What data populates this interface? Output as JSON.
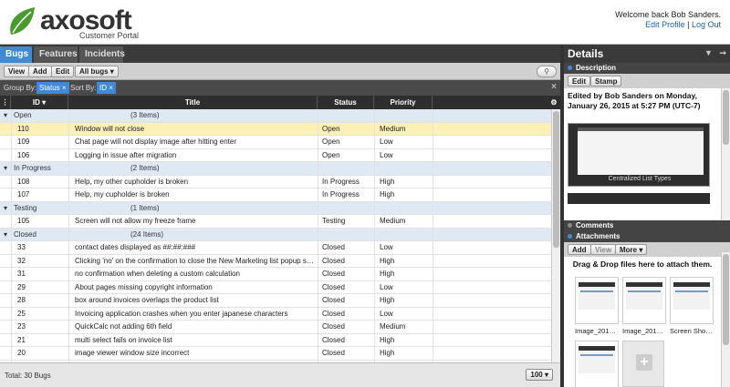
{
  "brand": {
    "name": "axosoft",
    "subtitle": "Customer Portal",
    "logo_color": "#4a9b2f"
  },
  "user": {
    "welcome": "Welcome back Bob Sanders.",
    "edit_profile": "Edit Profile",
    "separator": "|",
    "logout": "Log Out"
  },
  "tabs": [
    {
      "label": "Bugs",
      "active": true
    },
    {
      "label": "Features",
      "active": false
    },
    {
      "label": "Incidents",
      "active": false
    }
  ],
  "toolbar": {
    "view": "View",
    "add": "Add",
    "edit": "Edit",
    "filter": "All bugs",
    "search_icon": "search-icon"
  },
  "groupbar": {
    "group_label": "Group By:",
    "group_value": "Status",
    "sort_label": "Sort By:",
    "sort_value": "ID",
    "close": "×"
  },
  "columns": {
    "id": "ID",
    "title": "Title",
    "status": "Status",
    "priority": "Priority"
  },
  "groups": [
    {
      "name": "Open",
      "count": "(3 Items)",
      "rows": [
        {
          "id": "110",
          "title": "Window will not close",
          "status": "Open",
          "priority": "Medium",
          "selected": true
        },
        {
          "id": "109",
          "title": "Chat page will not display image after hitting enter",
          "status": "Open",
          "priority": "Low"
        },
        {
          "id": "106",
          "title": "Logging in issue after migration",
          "status": "Open",
          "priority": "Low"
        }
      ]
    },
    {
      "name": "In Progress",
      "count": "(2 Items)",
      "rows": [
        {
          "id": "108",
          "title": "Help, my other cupholder is broken",
          "status": "In Progress",
          "priority": "High"
        },
        {
          "id": "107",
          "title": "Help, my cupholder is broken",
          "status": "In Progress",
          "priority": "High"
        }
      ]
    },
    {
      "name": "Testing",
      "count": "(1 Items)",
      "rows": [
        {
          "id": "105",
          "title": "Screen will not allow my freeze frame",
          "status": "Testing",
          "priority": "Medium"
        }
      ]
    },
    {
      "name": "Closed",
      "count": "(24 Items)",
      "rows": [
        {
          "id": "33",
          "title": "contact dates displayed as ##:##:###",
          "status": "Closed",
          "priority": "Low"
        },
        {
          "id": "32",
          "title": "Clicking 'no' on the confirmation to close the New Marketing list popup s…",
          "status": "Closed",
          "priority": "High"
        },
        {
          "id": "31",
          "title": "no confirmation when deleting a custom calculation",
          "status": "Closed",
          "priority": "High"
        },
        {
          "id": "29",
          "title": "About pages missing copyright information",
          "status": "Closed",
          "priority": "Low"
        },
        {
          "id": "28",
          "title": "box around invoices overlaps the product list",
          "status": "Closed",
          "priority": "High"
        },
        {
          "id": "25",
          "title": "Invoicing application crashes when you enter japanese characters",
          "status": "Closed",
          "priority": "Low"
        },
        {
          "id": "23",
          "title": "QuickCalc not adding 6th field",
          "status": "Closed",
          "priority": "Medium"
        },
        {
          "id": "21",
          "title": "multi select fails on invoice list",
          "status": "Closed",
          "priority": "High"
        },
        {
          "id": "20",
          "title": "image viewer window size incorrect",
          "status": "Closed",
          "priority": "High"
        },
        {
          "id": "19",
          "title": "application close popup does not have window focus",
          "status": "Closed",
          "priority": "Low"
        }
      ]
    }
  ],
  "footer": {
    "total": "Total: 30 Bugs",
    "page_size": "100"
  },
  "details": {
    "title": "Details",
    "description_label": "Description",
    "edit": "Edit",
    "stamp": "Stamp",
    "description_text": "Edited by Bob Sanders on Monday, January 26, 2015 at 5:27 PM (UTC-7)",
    "screenshot_caption": "Centralized List Types",
    "comments_label": "Comments",
    "attachments_label": "Attachments",
    "add": "Add",
    "view": "View",
    "more": "More",
    "drop_text": "Drag & Drop files here to attach them.",
    "attachments": [
      "Image_201…",
      "Image_201…",
      "Screen Sho…"
    ]
  }
}
